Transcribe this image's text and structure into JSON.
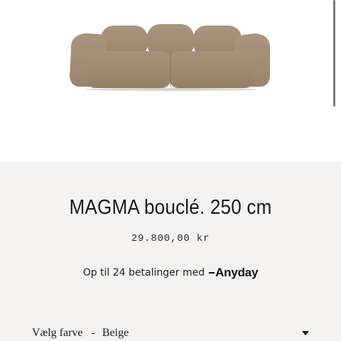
{
  "product": {
    "title": "MAGMA bouclé. 250 cm",
    "price": "29.800,00 kr",
    "installments_text": "Op til 24 betalinger med",
    "payment_provider": "Anyday"
  },
  "color_selector": {
    "label": "Vælg farve",
    "separator": "-",
    "selected": "Beige"
  },
  "colors": {
    "sofa": "#a48e78",
    "background": "#f4f3f2",
    "hero_background": "#ffffff"
  }
}
